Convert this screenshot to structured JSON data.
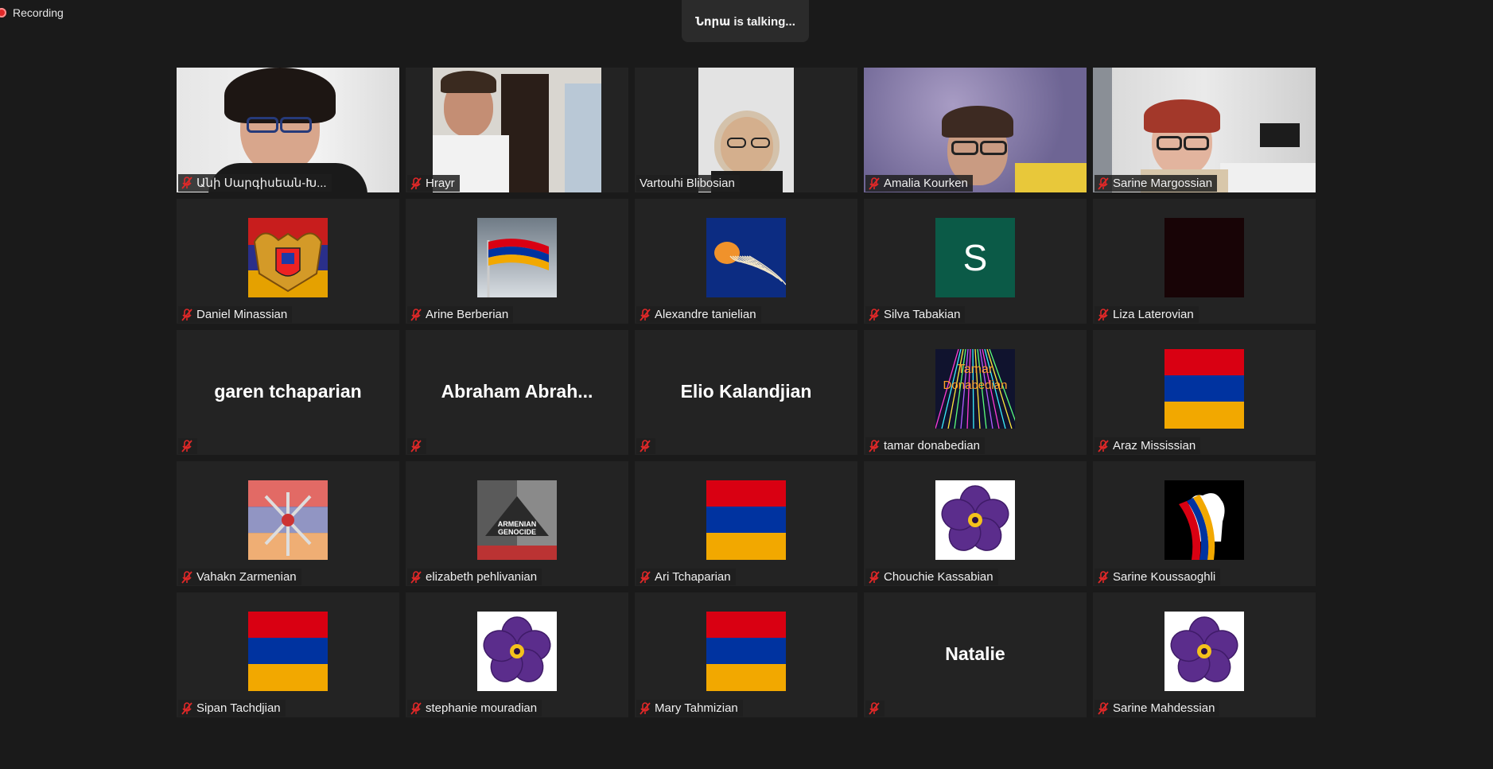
{
  "recording": {
    "label": "Recording"
  },
  "speaker_banner": {
    "text": "Նորա is talking..."
  },
  "participants": [
    {
      "name": "Անի Սարգիսեան-Խ...",
      "type": "video",
      "scene": "woman-dark",
      "muted": true
    },
    {
      "name": "Hrayr",
      "type": "video",
      "scene": "boy-room",
      "muted": true
    },
    {
      "name": "Vartouhi Blibosian",
      "type": "video",
      "scene": "woman-blonde",
      "muted": false
    },
    {
      "name": "Amalia Kourken",
      "type": "video",
      "scene": "woman-purple",
      "muted": true
    },
    {
      "name": "Sarine Margossian",
      "type": "video",
      "scene": "woman-redhair",
      "muted": true
    },
    {
      "name": "Daniel Minassian",
      "type": "avatar",
      "avatar": "coat-of-arms",
      "muted": true
    },
    {
      "name": "Arine Berberian",
      "type": "avatar",
      "avatar": "flag-waving",
      "muted": true
    },
    {
      "name": "Alexandre tanielian",
      "type": "avatar",
      "avatar": "jellyfish",
      "muted": true
    },
    {
      "name": "Silva Tabakian",
      "type": "avatar",
      "avatar": "letter",
      "letter": "S",
      "muted": true
    },
    {
      "name": "Liza Laterovian",
      "type": "avatar",
      "avatar": "dark-square",
      "muted": true
    },
    {
      "name": "garen tchaparian",
      "type": "name-only",
      "muted": true
    },
    {
      "name": "Abraham  Abrah...",
      "type": "name-only",
      "muted": true
    },
    {
      "name": "Elio Kalandjian",
      "type": "name-only",
      "muted": true
    },
    {
      "name": "tamar donabedian",
      "type": "avatar",
      "avatar": "neon-text",
      "avatar_text": "Tamar Donabedian",
      "muted": true
    },
    {
      "name": "Araz Mississian",
      "type": "avatar",
      "avatar": "flag",
      "muted": true
    },
    {
      "name": "Vahakn Zarmenian",
      "type": "avatar",
      "avatar": "emblem-sketch",
      "muted": true
    },
    {
      "name": "elizabeth pehlivanian",
      "type": "avatar",
      "avatar": "genocide-poster",
      "muted": true
    },
    {
      "name": "Ari Tchaparian",
      "type": "avatar",
      "avatar": "flag",
      "muted": true
    },
    {
      "name": "Chouchie Kassabian",
      "type": "avatar",
      "avatar": "forget-me-not",
      "muted": true
    },
    {
      "name": "Sarine Koussaoghli",
      "type": "avatar",
      "avatar": "fist-flag",
      "muted": true
    },
    {
      "name": "Sipan Tachdjian",
      "type": "avatar",
      "avatar": "flag",
      "muted": true
    },
    {
      "name": "stephanie mouradian",
      "type": "avatar",
      "avatar": "forget-me-not",
      "muted": true
    },
    {
      "name": "Mary Tahmizian",
      "type": "avatar",
      "avatar": "flag",
      "muted": true
    },
    {
      "name": "Natalie",
      "type": "name-only",
      "muted": true
    },
    {
      "name": "Sarine Mahdessian",
      "type": "avatar",
      "avatar": "forget-me-not",
      "muted": true
    }
  ],
  "colors": {
    "background": "#1a1a1a",
    "tile": "#232323",
    "flag_red": "#d90012",
    "flag_blue": "#0033a0",
    "flag_orange": "#f2a800",
    "muted_icon": "#e02828"
  }
}
